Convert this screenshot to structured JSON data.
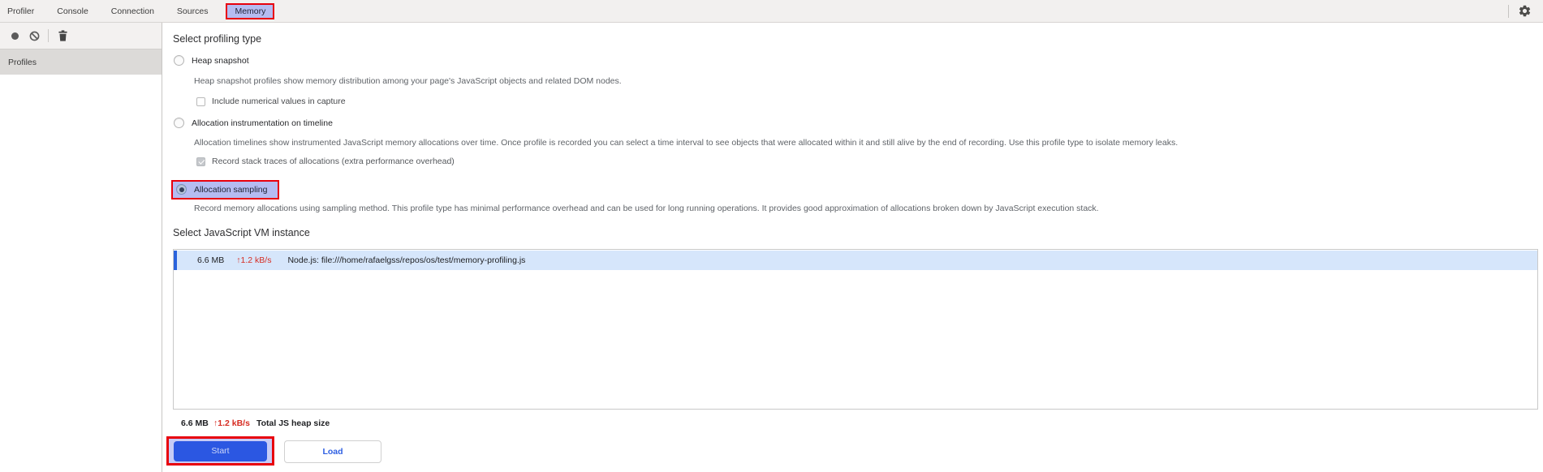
{
  "tabs": {
    "items": [
      "Profiler",
      "Console",
      "Connection",
      "Sources",
      "Memory"
    ],
    "active": "Memory"
  },
  "toolbar": {
    "icons": [
      "record-icon",
      "clear-all-icon",
      "trash-icon"
    ],
    "settings_icon": "gear-icon"
  },
  "sidebar": {
    "profiles_label": "Profiles"
  },
  "profiling": {
    "title": "Select profiling type",
    "options": [
      {
        "label": "Heap snapshot",
        "selected": false,
        "description": "Heap snapshot profiles show memory distribution among your page's JavaScript objects and related DOM nodes.",
        "suboption": {
          "label": "Include numerical values in capture",
          "checked": false
        }
      },
      {
        "label": "Allocation instrumentation on timeline",
        "selected": false,
        "description": "Allocation timelines show instrumented JavaScript memory allocations over time. Once profile is recorded you can select a time interval to see objects that were allocated within it and still alive by the end of recording. Use this profile type to isolate memory leaks.",
        "suboption": {
          "label": "Record stack traces of allocations (extra performance overhead)",
          "checked": true
        }
      },
      {
        "label": "Allocation sampling",
        "selected": true,
        "description": "Record memory allocations using sampling method. This profile type has minimal performance overhead and can be used for long running operations. It provides good approximation of allocations broken down by JavaScript execution stack."
      }
    ]
  },
  "vm": {
    "title": "Select JavaScript VM instance",
    "instances": [
      {
        "heap_size": "6.6 MB",
        "allocation_rate": "↑1.2 kB/s",
        "name": "Node.js: file:///home/rafaelgss/repos/os/test/memory-profiling.js",
        "selected": true
      }
    ],
    "total": {
      "heap_size": "6.6 MB",
      "allocation_rate": "↑1.2 kB/s",
      "label": "Total JS heap size"
    }
  },
  "actions": {
    "start_label": "Start",
    "load_label": "Load"
  },
  "colors": {
    "annotation_red": "#e8000d",
    "highlight_lavender": "#b5bcf1",
    "primary_button_blue": "#2b57e2",
    "selection_row_bg": "#d6e6fb",
    "selection_row_stripe": "#2a63dc",
    "rate_text_red": "#d62c22"
  }
}
